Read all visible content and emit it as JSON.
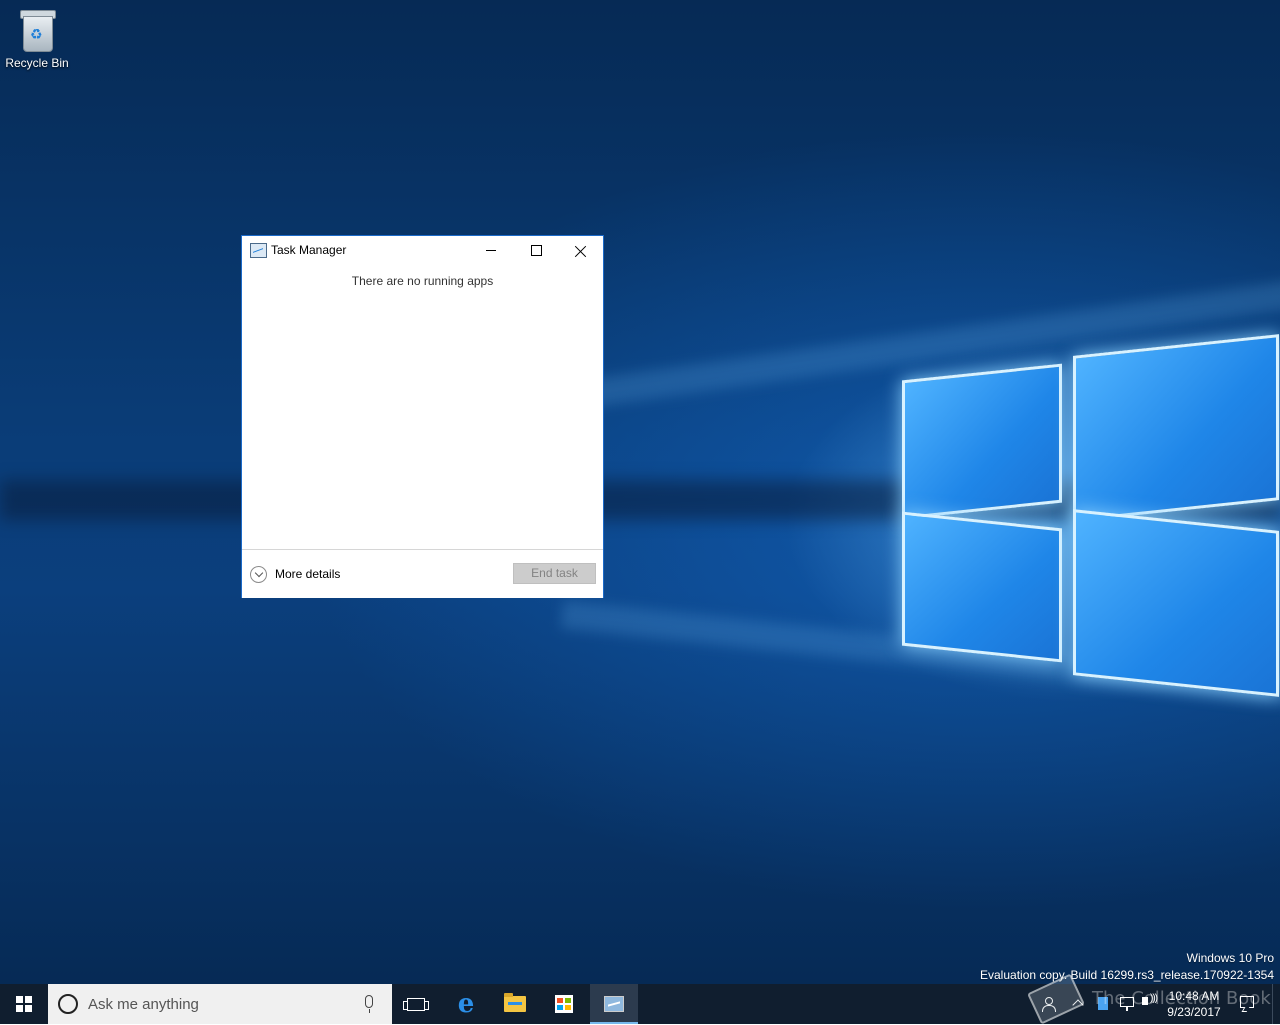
{
  "desktop": {
    "icons": [
      {
        "label": "Recycle Bin",
        "icon": "recycle-bin-icon"
      }
    ],
    "watermark": {
      "line1": "Windows 10 Pro",
      "line2": "Evaluation copy. Build 16299.rs3_release.170922-1354"
    }
  },
  "task_manager": {
    "title": "Task Manager",
    "empty_message": "There are no running apps",
    "more_details_label": "More details",
    "end_task_label": "End task",
    "end_task_disabled": true
  },
  "taskbar": {
    "search_placeholder": "Ask me anything",
    "pinned": [
      "task-view-icon",
      "edge-icon",
      "file-explorer-icon",
      "store-icon",
      "task-manager-icon"
    ],
    "active_app": "Task Manager",
    "clock": {
      "time": "10:48 AM",
      "date": "9/23/2017"
    },
    "overlay_text": "The Collection Book"
  },
  "colors": {
    "taskbar": "#101e2f",
    "accent": "#1b6ac9",
    "active_indicator": "#76b9ed"
  }
}
